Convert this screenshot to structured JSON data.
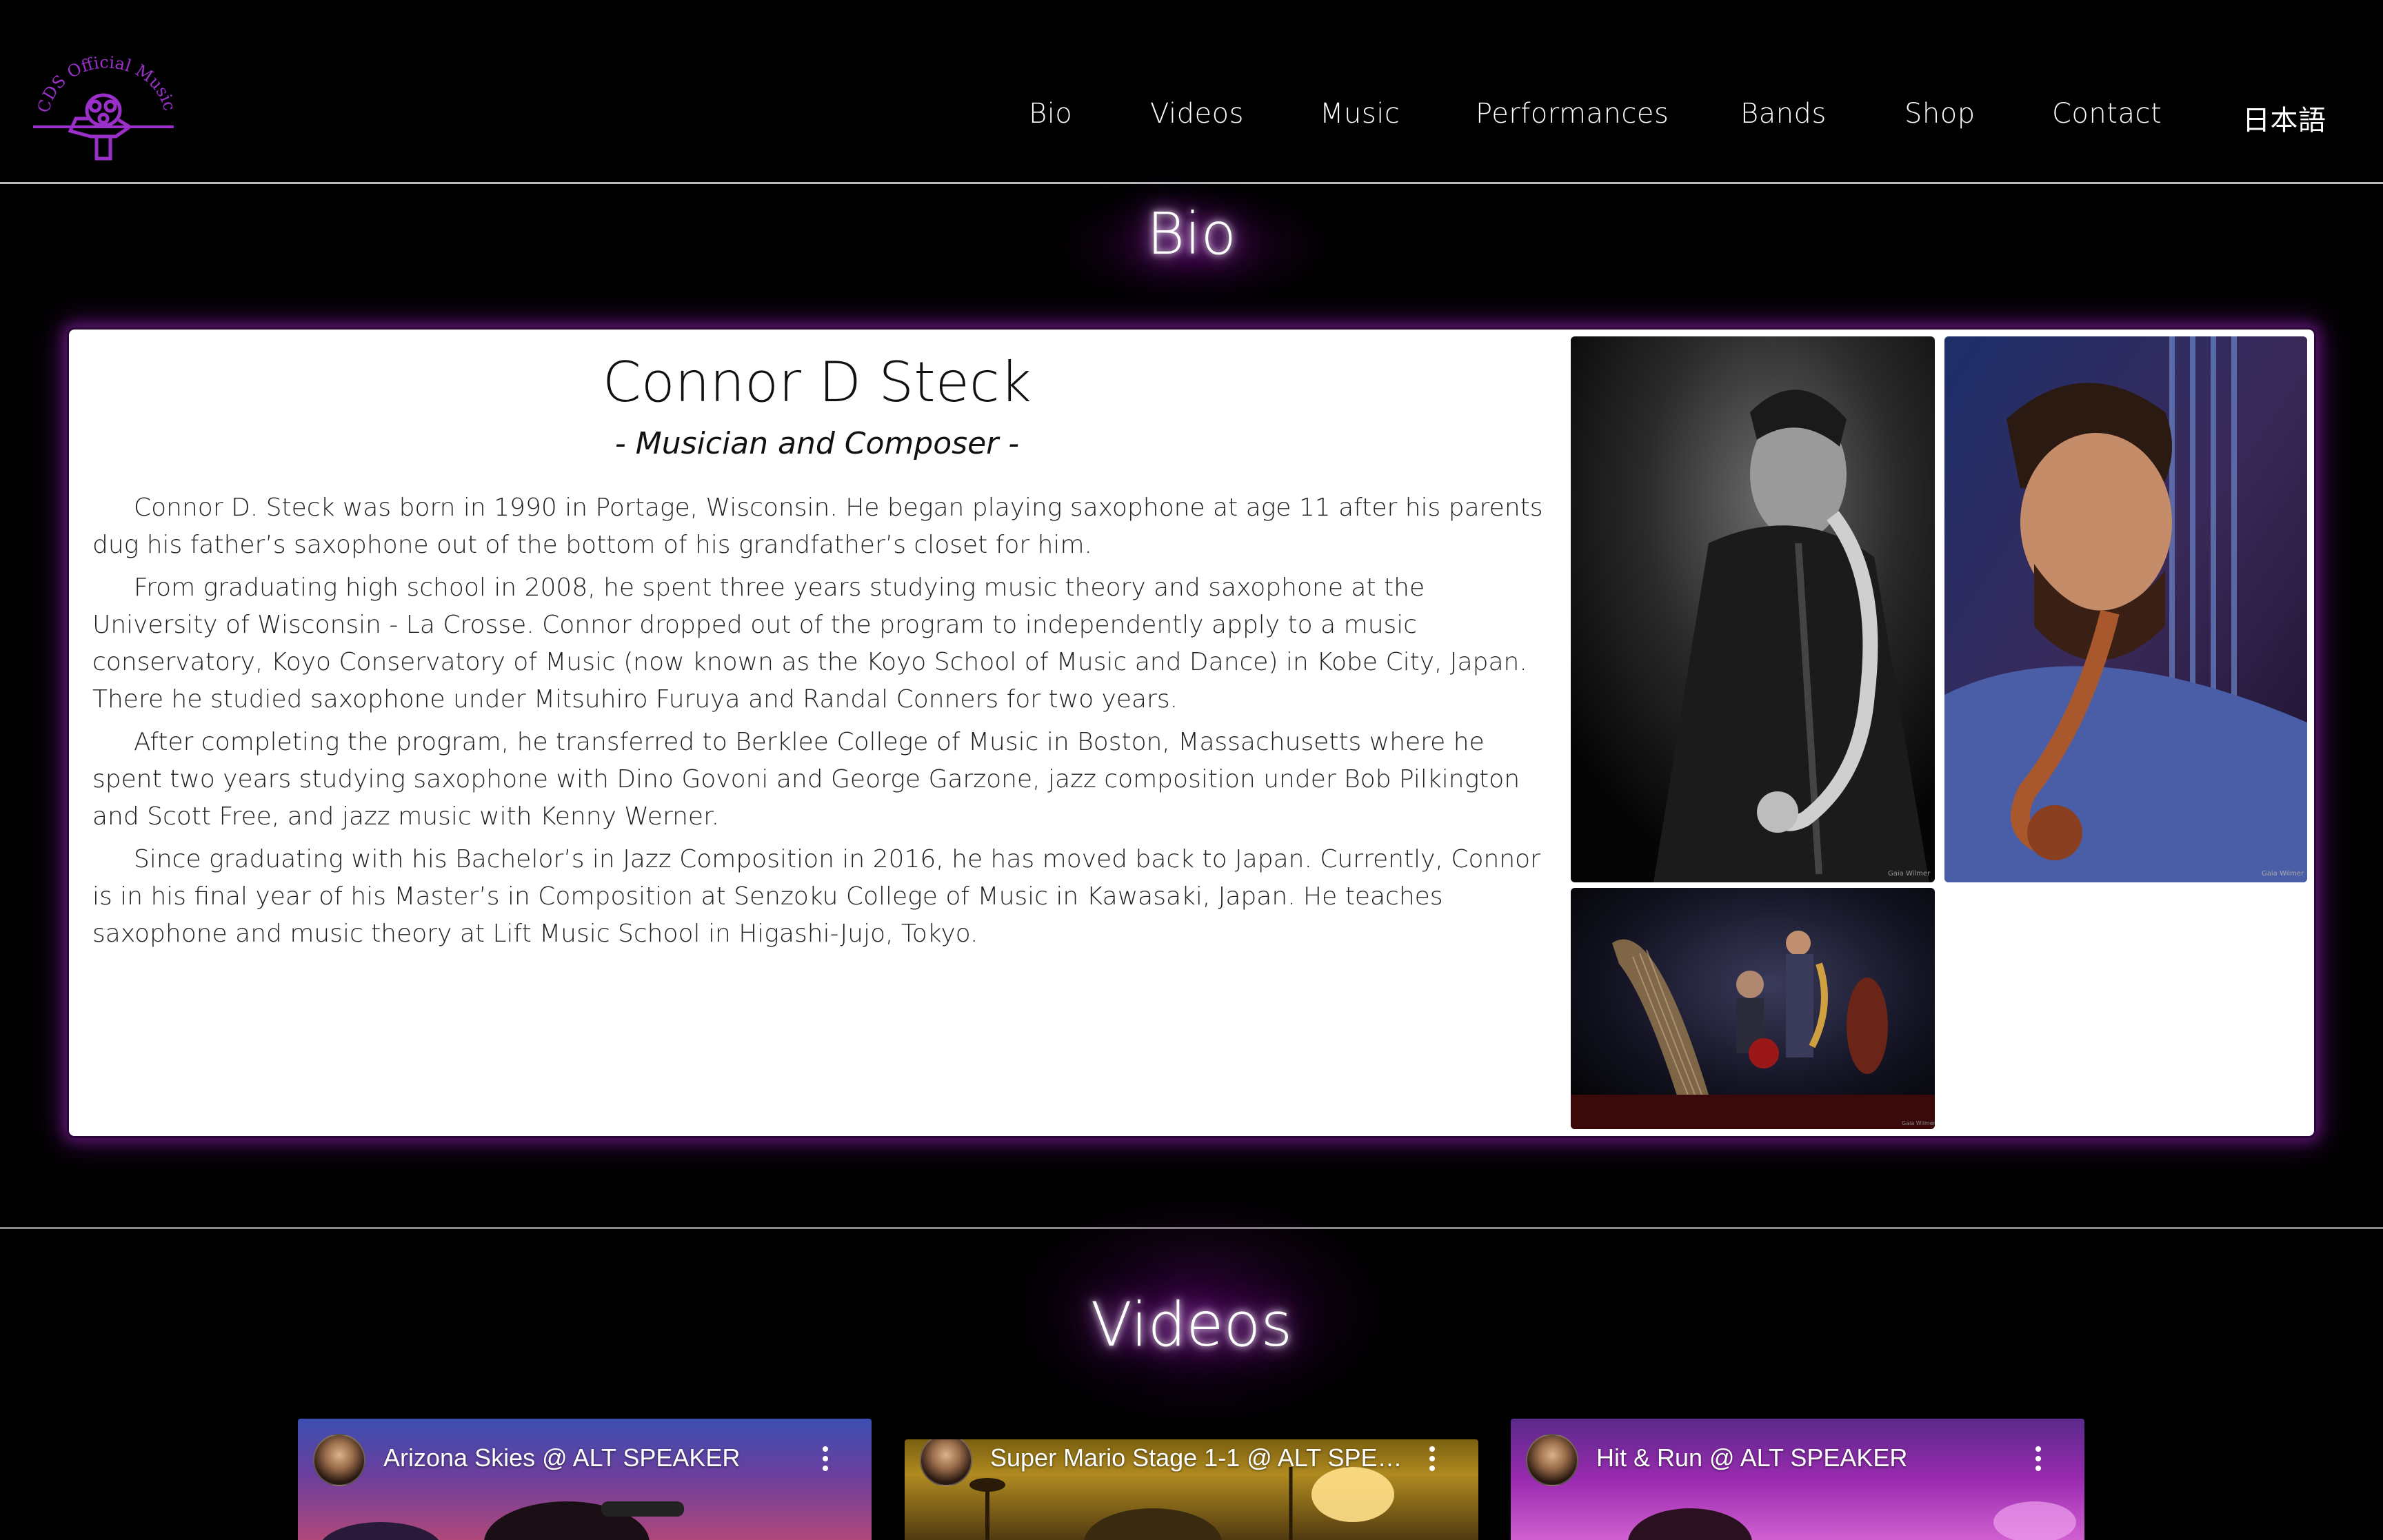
{
  "brand": {
    "logo_text": "CDS Official Music",
    "accent_color": "#9b2fc9"
  },
  "nav": {
    "items": [
      "Bio",
      "Videos",
      "Music",
      "Performances",
      "Bands",
      "Shop",
      "Contact",
      "日本語"
    ]
  },
  "bio": {
    "heading": "Bio",
    "name": "Connor D Steck",
    "subtitle": "- Musician and Composer -",
    "paragraphs": [
      "Connor D. Steck was born in 1990 in Portage, Wisconsin. He began playing saxophone at age 11 after his parents dug his father’s saxophone out of the bottom of his grandfather’s closet for him.",
      "From graduating high school in 2008, he spent three years studying music theory and saxophone at the University of Wisconsin - La Crosse. Connor dropped out of the program to independently apply to a music conservatory, Koyo Conservatory of Music (now known as the Koyo School of Music and Dance) in Kobe City, Japan. There he studied saxophone under Mitsuhiro Furuya and Randal Conners for two years.",
      "After completing the program, he transferred to Berklee College of Music in Boston, Massachusetts where he spent two years studying saxophone with Dino Govoni and George Garzone, jazz composition under Bob Pilkington and Scott Free, and jazz music with Kenny Werner.",
      "Since graduating with his Bachelor’s in Jazz Composition in 2016, he has moved back to Japan. Currently, Connor is in his final year of his Master’s in Composition at Senzoku College of Music in Kawasaki, Japan. He teaches saxophone and music theory at Lift Music School in Higashi-Jujo, Tokyo."
    ],
    "photos": [
      {
        "name": "photo-saxophonist-bw"
      },
      {
        "name": "photo-saxophonist-color"
      },
      {
        "name": "photo-band-stage"
      }
    ]
  },
  "videos": {
    "heading": "Videos",
    "items": [
      {
        "title": "Arizona Skies @ ALT SPEAKER"
      },
      {
        "title": "Super Mario Stage 1-1 @ ALT SPEA..."
      },
      {
        "title": "Hit & Run @ ALT SPEAKER"
      }
    ]
  }
}
